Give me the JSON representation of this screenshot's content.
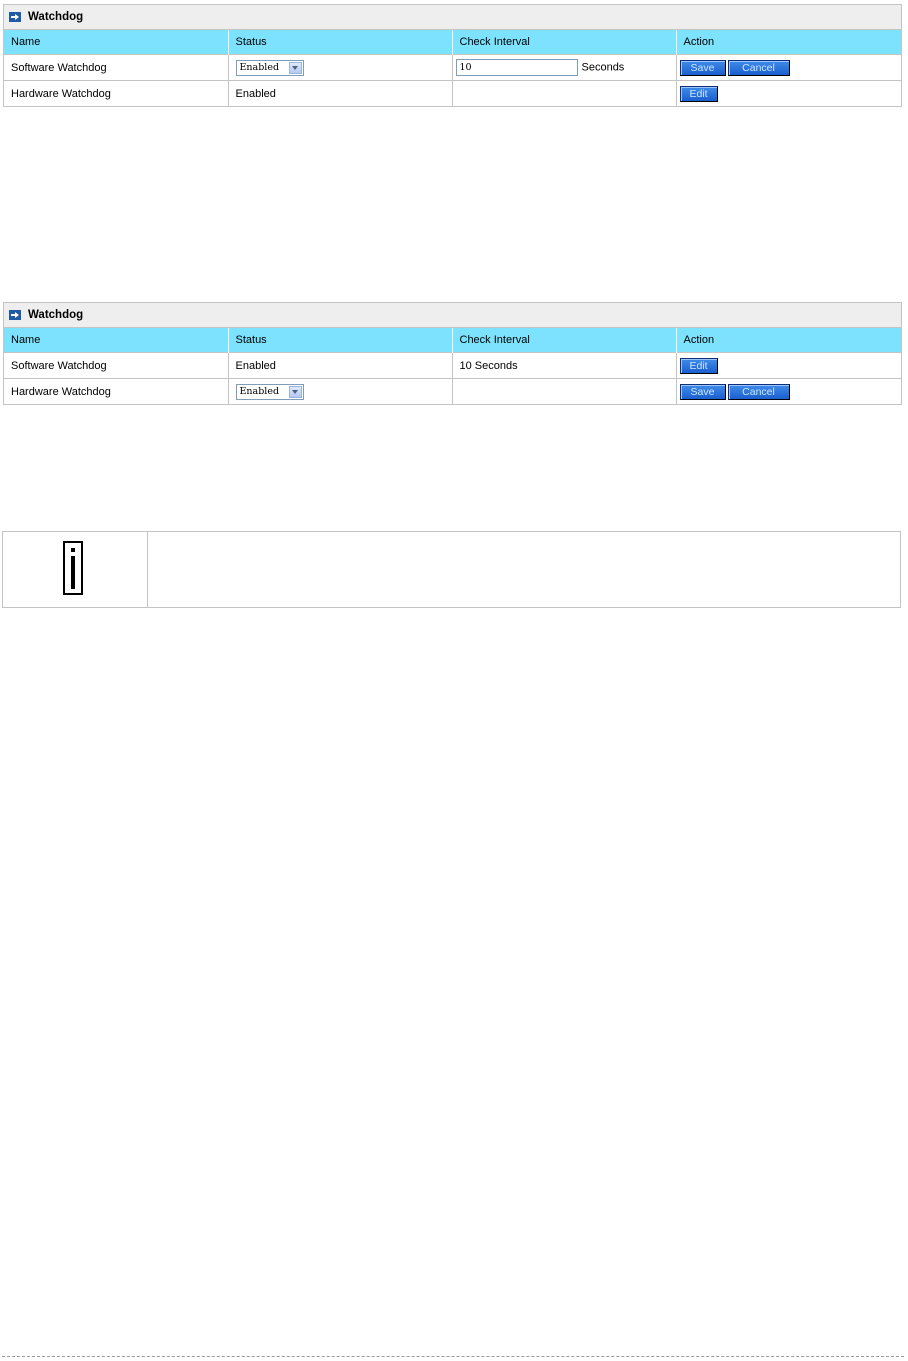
{
  "panel1": {
    "title": "Watchdog",
    "columns": [
      "Name",
      "Status",
      "Check Interval",
      "Action"
    ],
    "rows": [
      {
        "name": "Software Watchdog",
        "status_select": "Enabled",
        "interval_value": "10",
        "interval_unit": "Seconds",
        "save": "Save",
        "cancel": "Cancel"
      },
      {
        "name": "Hardware Watchdog",
        "status": "Enabled",
        "edit": "Edit"
      }
    ]
  },
  "panel2": {
    "title": "Watchdog",
    "columns": [
      "Name",
      "Status",
      "Check Interval",
      "Action"
    ],
    "rows": [
      {
        "name": "Software Watchdog",
        "status": "Enabled",
        "interval": "10 Seconds",
        "edit": "Edit"
      },
      {
        "name": "Hardware Watchdog",
        "status_select": "Enabled",
        "save": "Save",
        "cancel": "Cancel"
      }
    ]
  },
  "colors": {
    "header_bg": "#7de2fd",
    "button_bg": "#2b74de",
    "panel_title_bg": "#eeeeee"
  },
  "icons": {
    "panel_arrow": "arrow-right-icon",
    "note": "info-icon"
  }
}
